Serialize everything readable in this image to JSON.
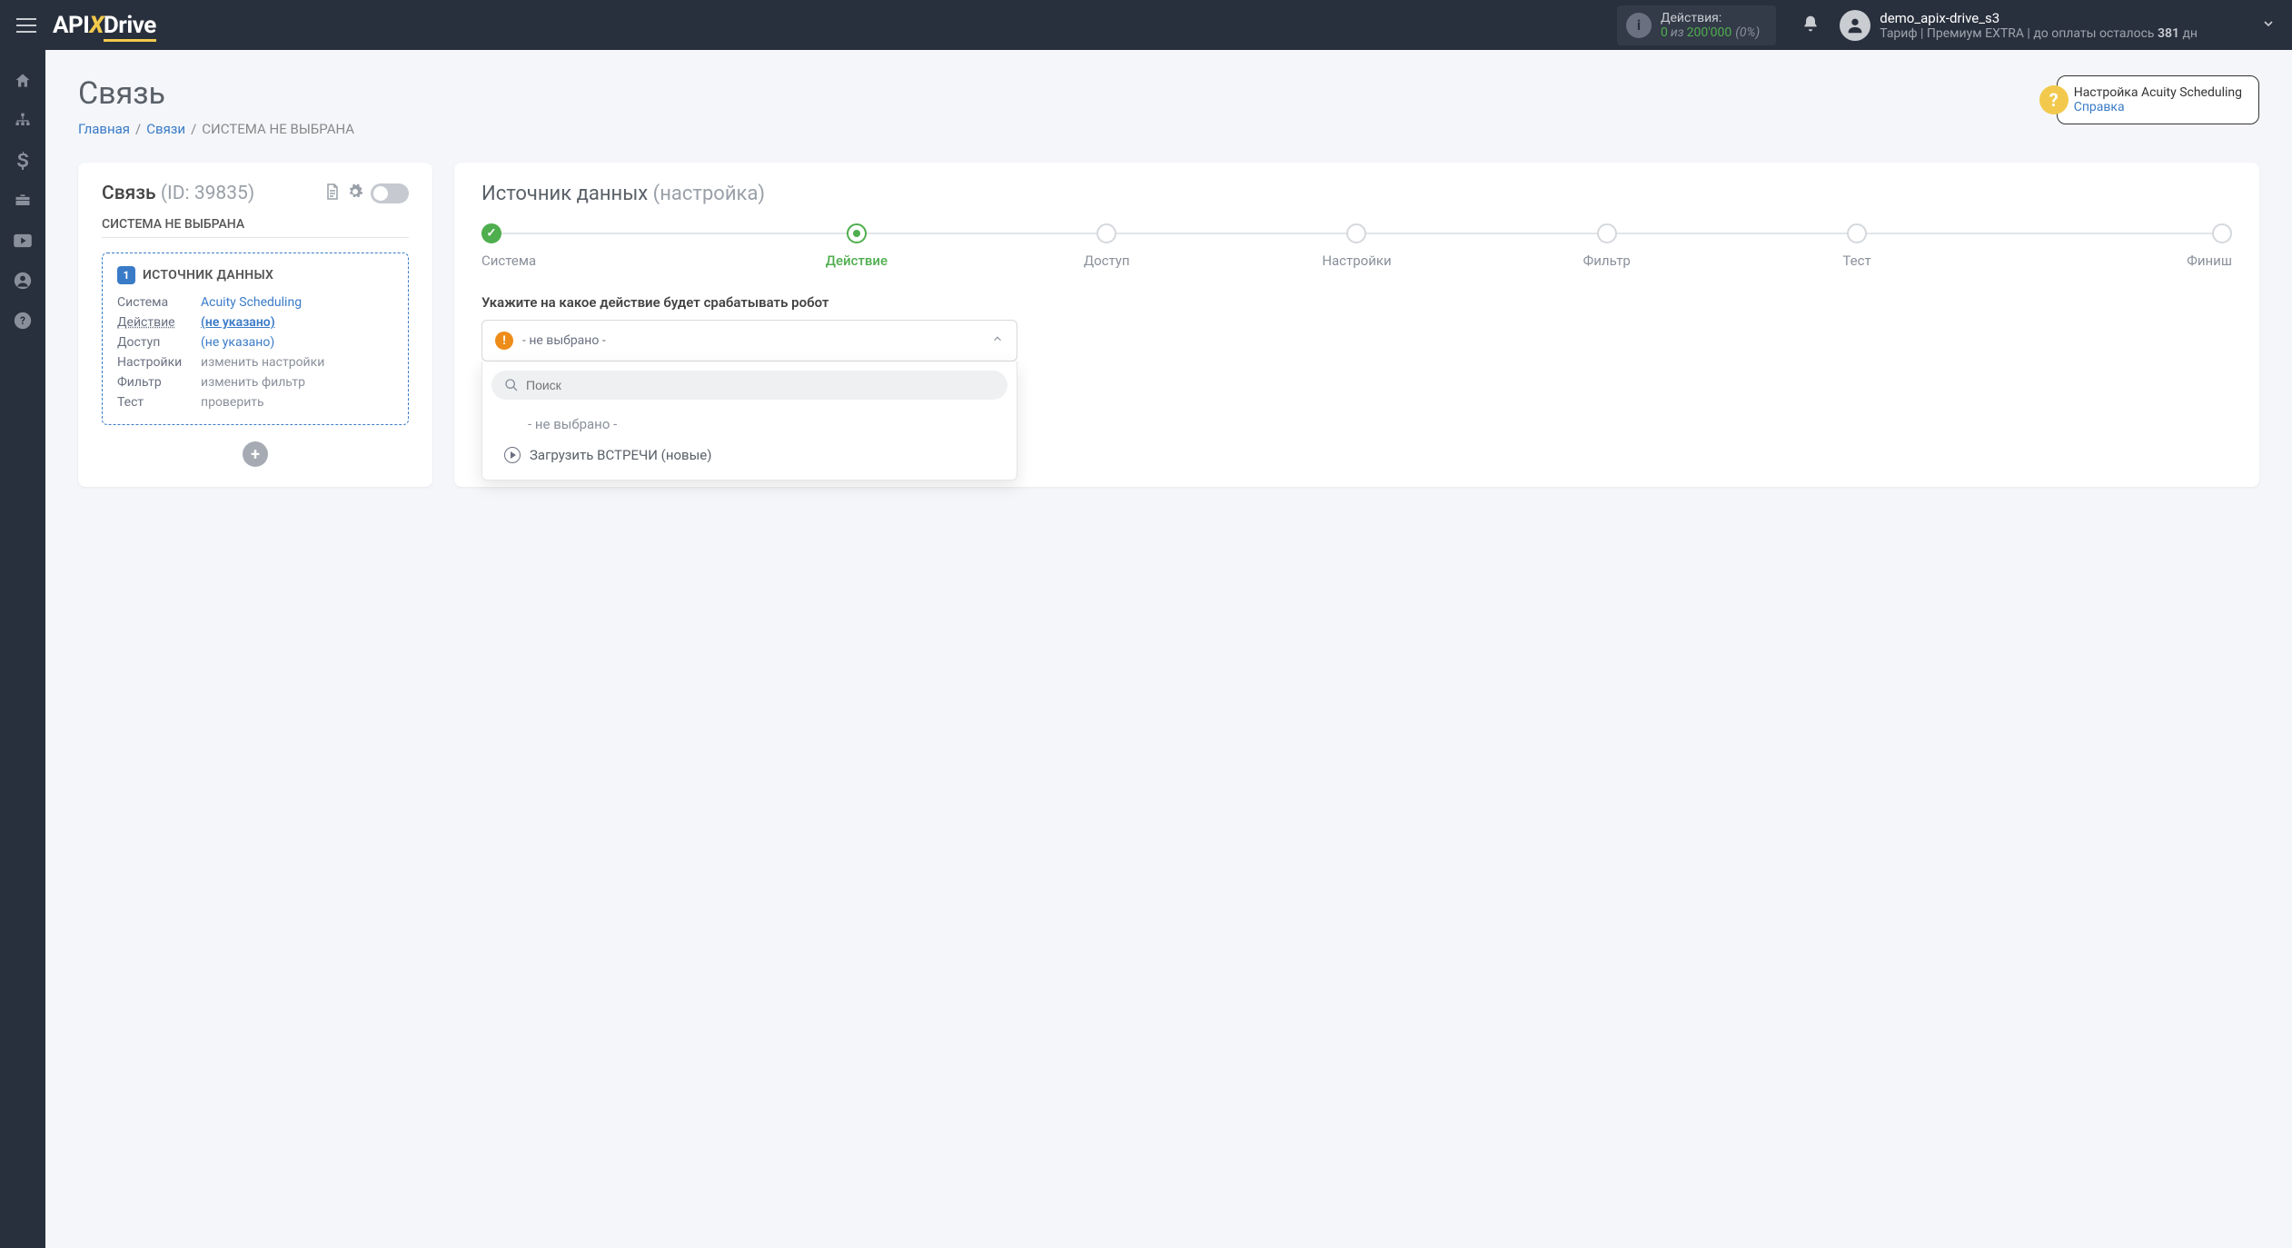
{
  "topbar": {
    "logo_pre": "API",
    "logo_x": "X",
    "logo_post": "Drive",
    "actions_label": "Действия:",
    "actions_used": "0",
    "actions_of": "из",
    "actions_limit": "200'000",
    "actions_pct": "(0%)",
    "username": "demo_apix-drive_s3",
    "tariff_pre": "Тариф  | Премиум EXTRA |  до оплаты осталось ",
    "tariff_days": "381",
    "tariff_post": " дн"
  },
  "page": {
    "title": "Связь",
    "crumb_home": "Главная",
    "crumb_links": "Связи",
    "crumb_current": "СИСТЕМА НЕ ВЫБРАНА"
  },
  "help": {
    "title": "Настройка Acuity Scheduling",
    "link": "Справка"
  },
  "leftcard": {
    "title": "Связь",
    "id_label": "(ID: 39835)",
    "subtitle": "СИСТЕМА НЕ ВЫБРАНА",
    "block_num": "1",
    "block_title": "ИСТОЧНИК ДАННЫХ",
    "rows": {
      "system_l": "Система",
      "system_v": "Acuity Scheduling",
      "action_l": "Действие",
      "action_v": "(не указано)",
      "access_l": "Доступ",
      "access_v": "(не указано)",
      "settings_l": "Настройки",
      "settings_v": "изменить настройки",
      "filter_l": "Фильтр",
      "filter_v": "изменить фильтр",
      "test_l": "Тест",
      "test_v": "проверить"
    }
  },
  "rightcard": {
    "title": "Источник данных",
    "title_sub": "(настройка)",
    "steps": [
      "Система",
      "Действие",
      "Доступ",
      "Настройки",
      "Фильтр",
      "Тест",
      "Финиш"
    ],
    "form_label": "Укажите на какое действие будет срабатывать робот",
    "select_text": "- не выбрано -",
    "search_ph": "Поиск",
    "opt_none": "- не выбрано -",
    "opt_load": "Загрузить ВСТРЕЧИ (новые)"
  }
}
